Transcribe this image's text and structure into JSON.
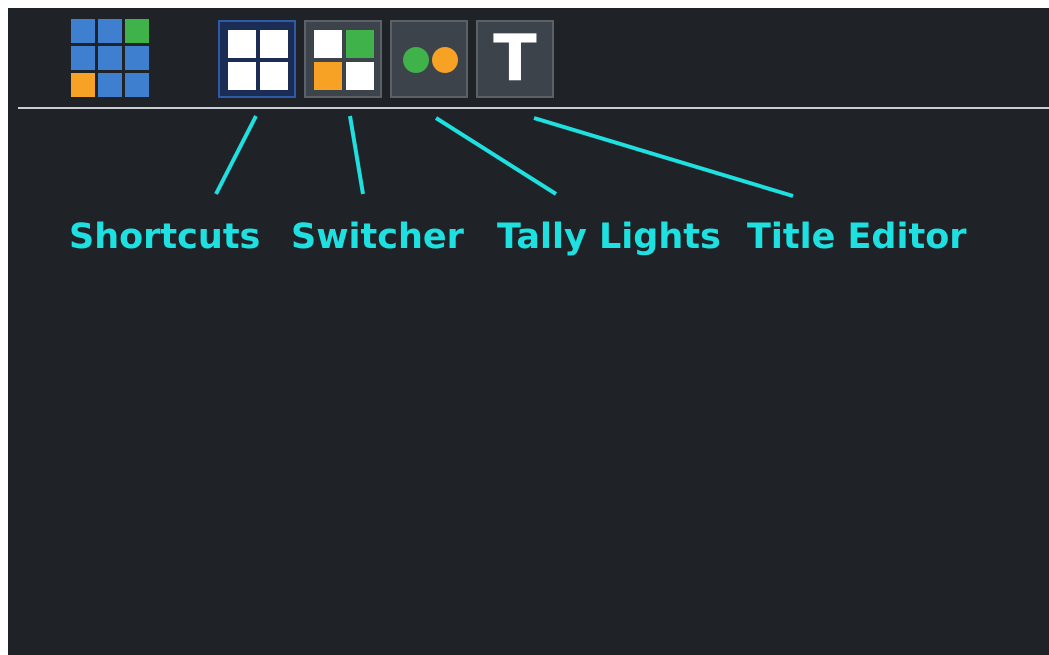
{
  "colors": {
    "background": "#1f2226",
    "accent_cyan": "#1ee0e0",
    "tile_blue": "#3f7fd0",
    "tile_green": "#3fb24a",
    "tile_orange": "#f7a224",
    "tile_white": "#ffffff"
  },
  "app_logo": {
    "icon": "app-grid-icon",
    "tiles": [
      "blue",
      "blue",
      "green",
      "blue",
      "blue",
      "blue",
      "orange",
      "blue",
      "blue"
    ]
  },
  "toolbar": {
    "buttons": [
      {
        "id": "shortcuts",
        "icon": "four-square-grid-icon",
        "active": true
      },
      {
        "id": "switcher",
        "icon": "switcher-grid-icon",
        "cells": [
          "white",
          "green",
          "orange",
          "white"
        ],
        "active": false
      },
      {
        "id": "tally",
        "icon": "tally-lights-icon",
        "dots": [
          "green",
          "orange"
        ],
        "active": false
      },
      {
        "id": "title",
        "icon": "title-t-icon",
        "glyph": "T",
        "active": false
      }
    ]
  },
  "callouts": {
    "shortcuts": "Shortcuts",
    "switcher": "Switcher",
    "tally": "Tally Lights",
    "title": "Title Editor"
  }
}
